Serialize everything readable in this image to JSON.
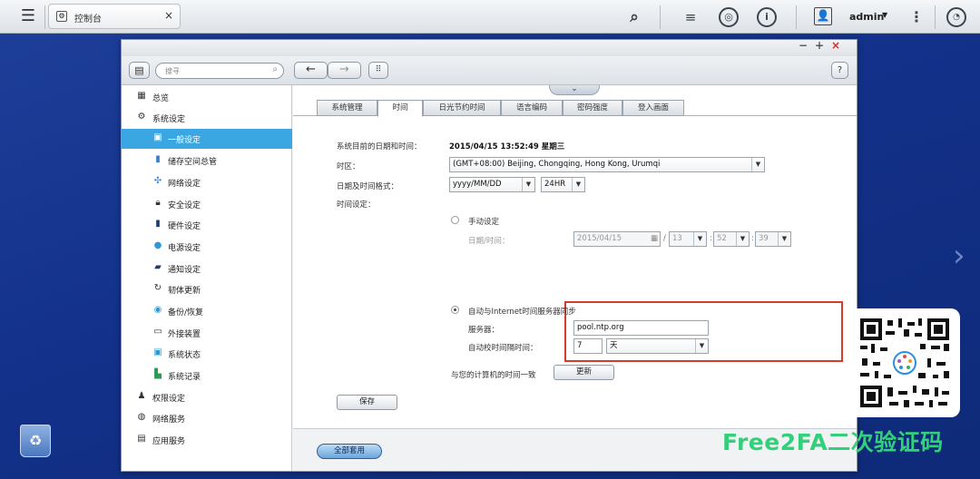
{
  "topbar": {
    "tab_label": "控制台",
    "user_name": "admin"
  },
  "window": {
    "search_placeholder": "搜寻",
    "help_label": "?"
  },
  "sidebar": {
    "items": [
      {
        "label": "总览",
        "icon": "overview-icon"
      },
      {
        "label": "系统设定",
        "icon": "gear-icon"
      },
      {
        "label": "一般设定",
        "icon": "general-settings-icon"
      },
      {
        "label": "储存空间总管",
        "icon": "storage-icon"
      },
      {
        "label": "网络设定",
        "icon": "network-icon"
      },
      {
        "label": "安全设定",
        "icon": "lock-icon"
      },
      {
        "label": "硬件设定",
        "icon": "hardware-icon"
      },
      {
        "label": "电源设定",
        "icon": "bulb-icon"
      },
      {
        "label": "通知设定",
        "icon": "notification-icon"
      },
      {
        "label": "韧体更新",
        "icon": "firmware-icon"
      },
      {
        "label": "备份/恢复",
        "icon": "backup-icon"
      },
      {
        "label": "外接装置",
        "icon": "external-device-icon"
      },
      {
        "label": "系统状态",
        "icon": "status-icon"
      },
      {
        "label": "系统记录",
        "icon": "log-icon"
      },
      {
        "label": "权限设定",
        "icon": "user-icon"
      },
      {
        "label": "网络服务",
        "icon": "globe-icon"
      },
      {
        "label": "应用服务",
        "icon": "app-service-icon"
      }
    ]
  },
  "subtabs": [
    "系统管理",
    "时间",
    "日光节约时间",
    "语言编码",
    "密码强度",
    "登入画面"
  ],
  "form": {
    "current_datetime_label": "系统目前的日期和时间：",
    "current_datetime_value": "2015/04/15 13:52:49 星期三",
    "timezone_label": "时区：",
    "timezone_value": "(GMT+08:00) Beijing, Chongqing, Hong Kong, Urumqi",
    "format_label": "日期及时间格式：",
    "date_format_value": "yyyy/MM/DD",
    "time_format_value": "24HR",
    "time_setting_label": "时间设定：",
    "manual_label": "手动设定",
    "manual_datetime_label": "日期/时间：",
    "manual_date_value": "2015/04/15",
    "manual_hour": "13",
    "manual_minute": "52",
    "manual_second": "39",
    "slash": "/",
    "colon": ":",
    "auto_label": "自动与Internet时间服务器同步",
    "server_label": "服务器：",
    "server_value": "pool.ntp.org",
    "interval_label": "自动校时间隔时间：",
    "interval_value": "7",
    "interval_unit": "天",
    "sync_pc_label": "与您的计算机的时间一致",
    "update_button": "更新",
    "save_button": "保存",
    "apply_all_button": "全部套用"
  },
  "watermark": {
    "brand_text": "Free2FA二次验证码"
  }
}
